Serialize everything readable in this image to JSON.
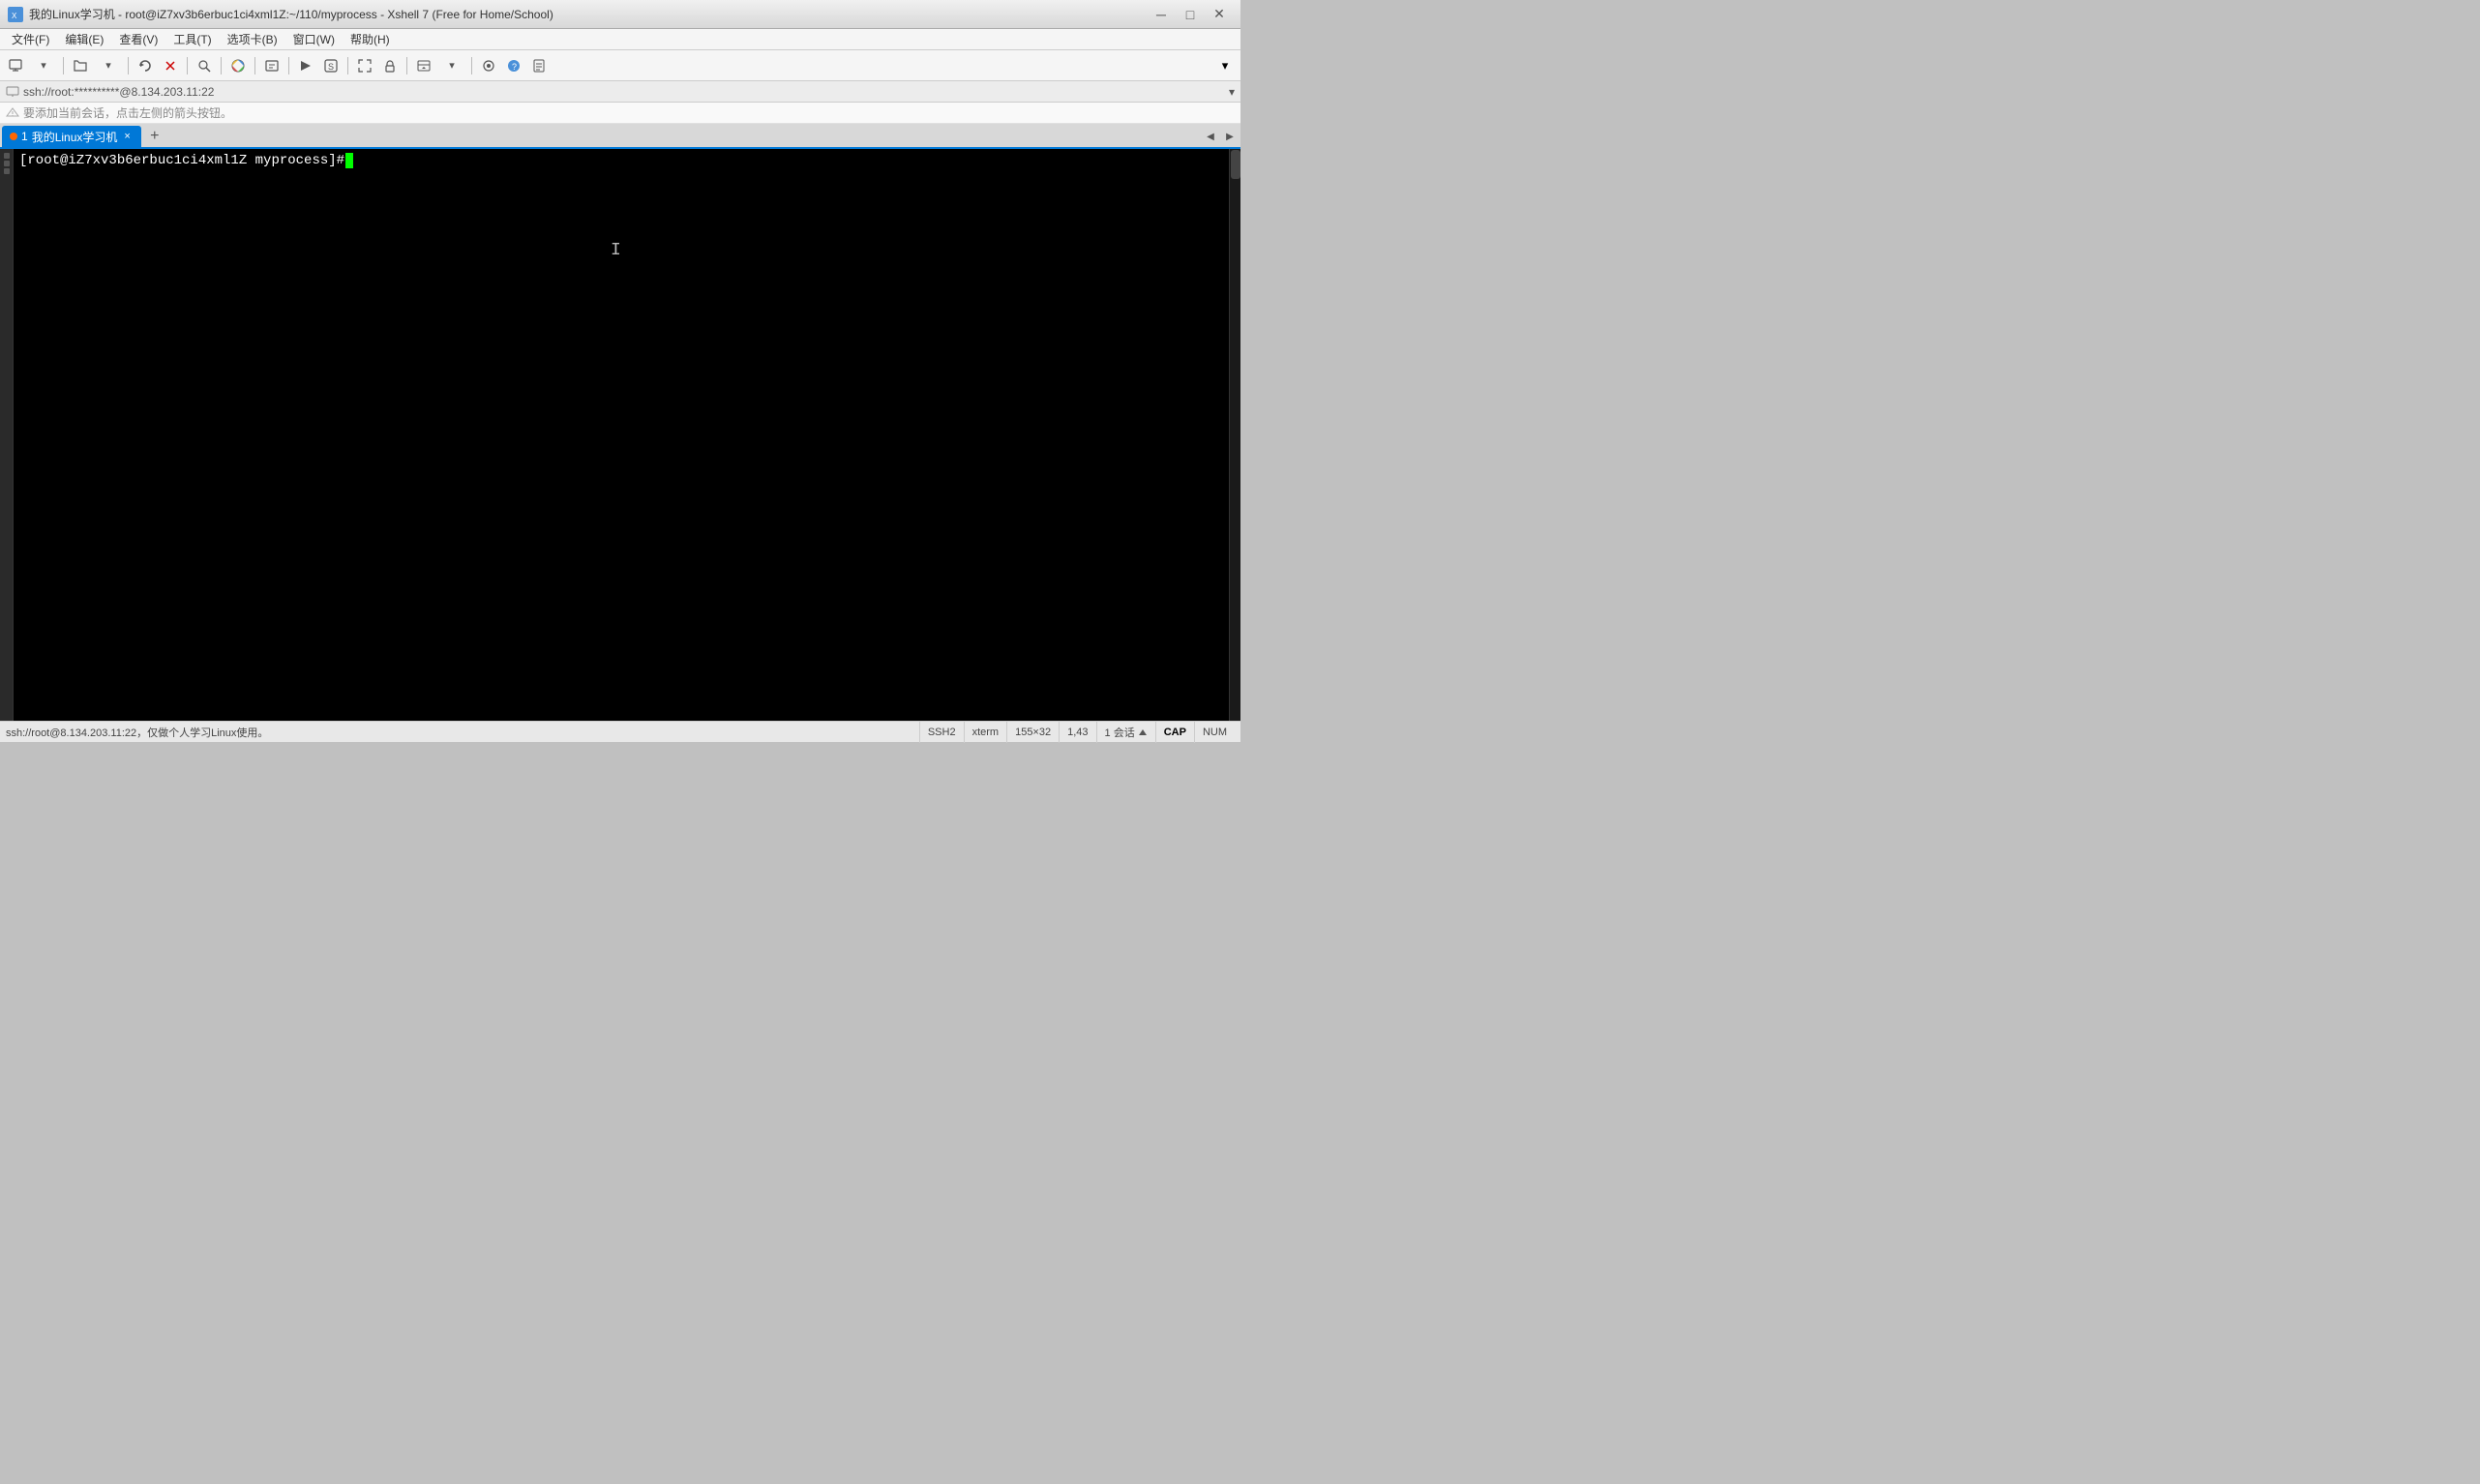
{
  "window": {
    "title": "我的Linux学习机 - root@iZ7xv3b6erbuc1ci4xml1Z:~/110/myprocess - Xshell 7 (Free for Home/School)"
  },
  "titlebar": {
    "minimize_label": "─",
    "maximize_label": "□",
    "close_label": "✕"
  },
  "menubar": {
    "items": [
      {
        "label": "文件(F)"
      },
      {
        "label": "编辑(E)"
      },
      {
        "label": "查看(V)"
      },
      {
        "label": "工具(T)"
      },
      {
        "label": "选项卡(B)"
      },
      {
        "label": "窗口(W)"
      },
      {
        "label": "帮助(H)"
      }
    ]
  },
  "session_bar": {
    "text": "ssh://root:**********@8.134.203.11:22"
  },
  "notice_bar": {
    "text": "要添加当前会话，点击左侧的箭头按钮。"
  },
  "tab": {
    "number": "1",
    "label": "我的Linux学习机",
    "close": "×",
    "add": "+"
  },
  "terminal": {
    "prompt": "[root@iZ7xv3b6erbuc1ci4xml1Z myprocess]# "
  },
  "statusbar": {
    "left_text": "ssh://root@8.134.203.11:22，仅做个人学习Linux使用。",
    "protocol": "SSH2",
    "term": "xterm",
    "size": "155×32",
    "cursor": "1,43",
    "sessions": "1 会话",
    "cap": "CAP",
    "num": "NUM"
  }
}
